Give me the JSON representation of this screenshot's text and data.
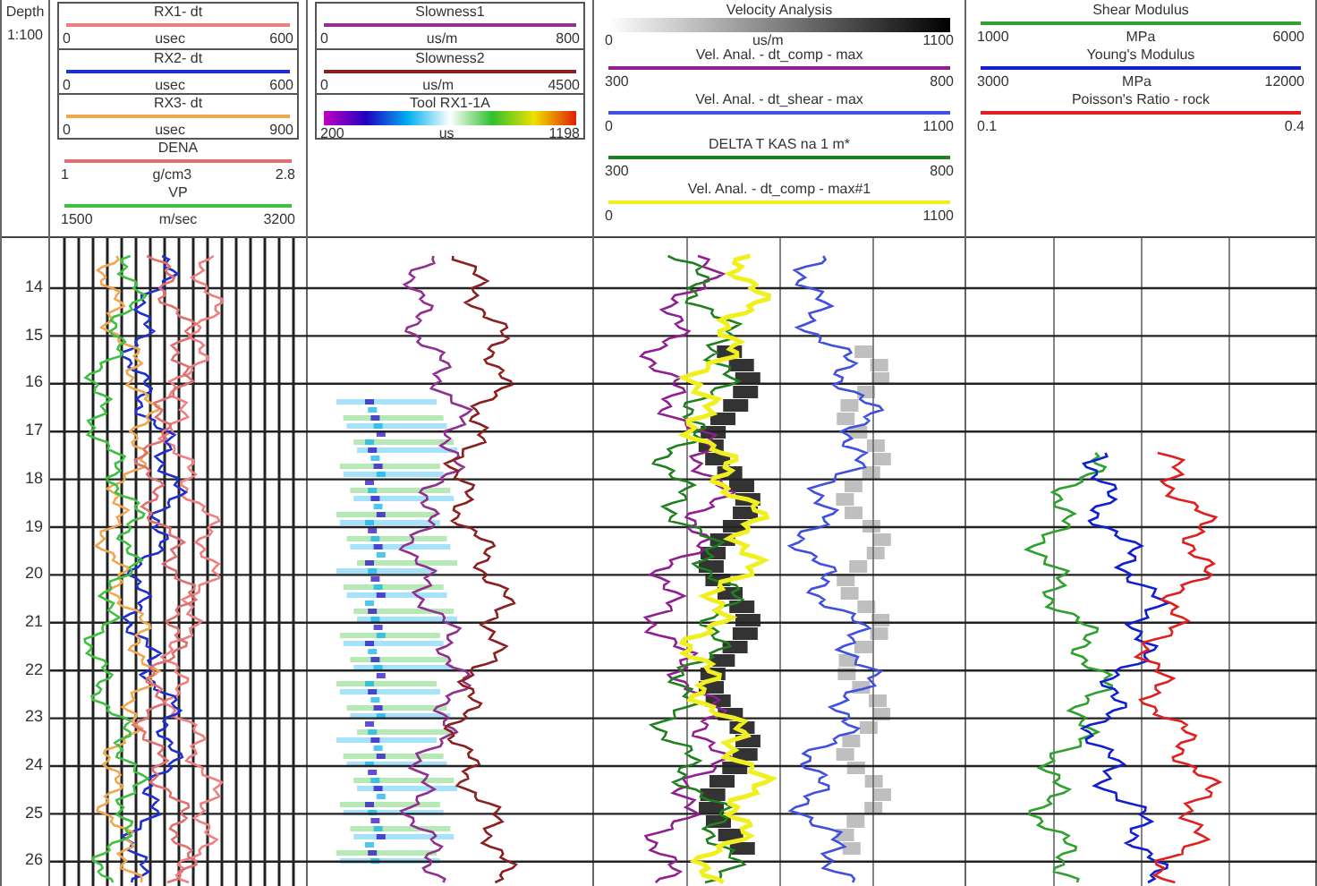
{
  "depth_track": {
    "title": "Depth",
    "scale": "1:100",
    "labels": [
      "14",
      "15",
      "16",
      "17",
      "18",
      "19",
      "20",
      "21",
      "22",
      "23",
      "24",
      "25",
      "26"
    ]
  },
  "tracks": [
    {
      "kind": "grid",
      "boxed_curves": [
        {
          "name": "RX1- dt",
          "kind": "line",
          "color": "#f08080",
          "min": "0",
          "unit": "usec",
          "max": "600"
        },
        {
          "name": "RX2- dt",
          "kind": "line",
          "color": "#2030d0",
          "min": "0",
          "unit": "usec",
          "max": "600"
        },
        {
          "name": "RX3- dt",
          "kind": "line",
          "color": "#f0a850",
          "min": "0",
          "unit": "usec",
          "max": "900"
        }
      ],
      "curves": [
        {
          "name": "DENA",
          "kind": "line",
          "color": "#e07070",
          "min": "1",
          "unit": "g/cm3",
          "max": "2.8"
        },
        {
          "name": "VP",
          "kind": "line",
          "color": "#40c040",
          "min": "1500",
          "unit": "m/sec",
          "max": "3200"
        }
      ]
    },
    {
      "kind": "waveform",
      "boxed_curves": [
        {
          "name": "Slowness1",
          "kind": "line",
          "color": "#903090",
          "min": "0",
          "unit": "us/m",
          "max": "800"
        },
        {
          "name": "Slowness2",
          "kind": "line",
          "color": "#8b2020",
          "min": "0",
          "unit": "us/m",
          "max": "4500"
        },
        {
          "name": "Tool RX1-1A",
          "kind": "rainbow_bar",
          "min": "200",
          "unit": "us",
          "max": "1198"
        }
      ]
    },
    {
      "kind": "density",
      "curves": [
        {
          "name": "Velocity Analysis",
          "kind": "grayscale_bar",
          "min": "0",
          "unit": "us/m",
          "max": "1100"
        },
        {
          "name": "Vel. Anal. - dt_comp - max",
          "kind": "line",
          "color": "#902090",
          "min": "300",
          "max": "800"
        },
        {
          "name": "Vel. Anal. - dt_shear - max",
          "kind": "line",
          "color": "#4050e0",
          "min": "0",
          "max": "1100"
        },
        {
          "name": "DELTA T KAS na 1 m*",
          "kind": "line",
          "color": "#208020",
          "min": "300",
          "max": "800"
        },
        {
          "name": "Vel. Anal. - dt_comp - max#1",
          "kind": "line",
          "color": "#f0f020",
          "min": "0",
          "max": "1100"
        }
      ]
    },
    {
      "kind": "plain",
      "curves": [
        {
          "name": "Shear Modulus",
          "kind": "line",
          "color": "#30a030",
          "min": "1000",
          "unit": "MPa",
          "max": "6000"
        },
        {
          "name": "Young's Modulus",
          "kind": "line",
          "color": "#1020d0",
          "min": "3000",
          "unit": "MPa",
          "max": "12000"
        },
        {
          "name": "Poisson's Ratio - rock",
          "kind": "line",
          "color": "#e02020",
          "min": "0.1",
          "max": "0.4"
        }
      ]
    }
  ]
}
